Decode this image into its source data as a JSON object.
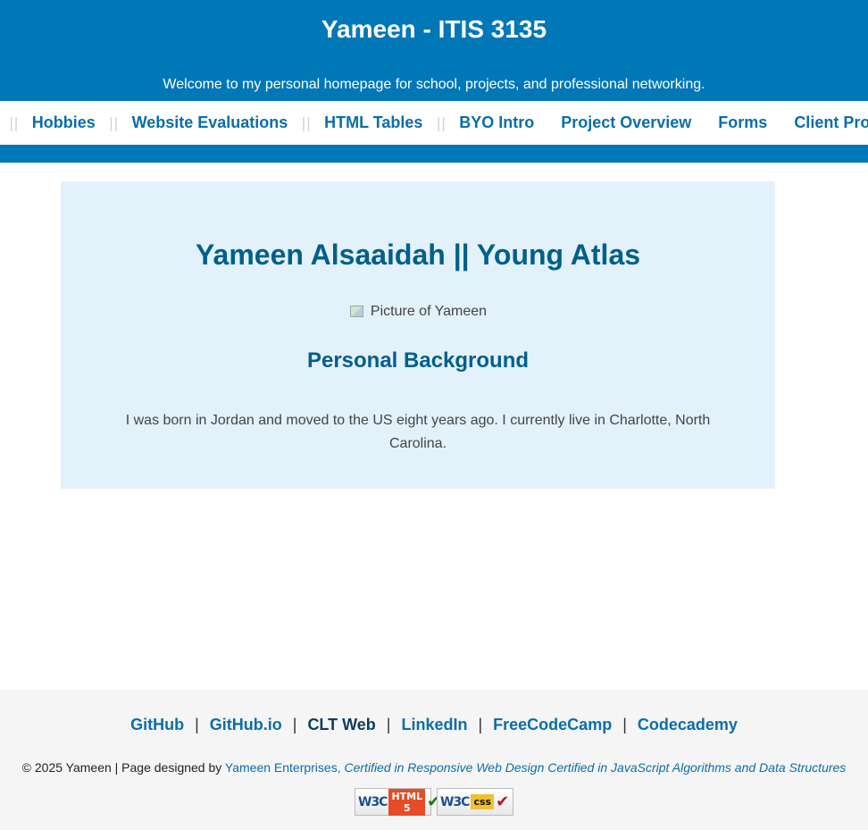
{
  "header": {
    "title": "Yameen - ITIS 3135",
    "tagline": "Welcome to my personal homepage for school, projects, and professional networking."
  },
  "nav": {
    "separator": "||",
    "items": [
      {
        "label": "Hobbies"
      },
      {
        "label": "Website Evaluations"
      },
      {
        "label": "HTML Tables"
      },
      {
        "label": "BYO Intro"
      },
      {
        "label": "Project Overview"
      },
      {
        "label": "Forms"
      },
      {
        "label": "Client Project"
      }
    ]
  },
  "main": {
    "name": "Yameen Alsaaidah || Young Atlas",
    "photo_alt": "Picture of Yameen",
    "section_heading": "Personal Background",
    "bio": "I was born in Jordan and moved to the US eight years ago. I currently live in Charlotte, North Carolina."
  },
  "footer": {
    "links": [
      {
        "label": "GitHub"
      },
      {
        "label": "GitHub.io"
      },
      {
        "label": "CLT Web"
      },
      {
        "label": "LinkedIn"
      },
      {
        "label": "FreeCodeCamp"
      },
      {
        "label": "Codecademy"
      }
    ],
    "pipe": "|",
    "copyright": "© 2025 Yameen | Page designed by ",
    "company": "Yameen Enterprises,",
    "certifications": "Certified in Responsive Web Design Certified in JavaScript Algorithms and Data Structures",
    "badges": {
      "html": {
        "w3c": "W3C",
        "tag": "HTML 5",
        "check": "✔"
      },
      "css": {
        "w3c": "W3C",
        "tag": "css",
        "check": "✔"
      }
    }
  },
  "colors": {
    "brand_blue": "#0077b6",
    "link_blue": "#0a6ea8",
    "heading_blue": "#005f8a",
    "content_bg": "#e3f1fb",
    "footer_bg": "#f5f5f5"
  }
}
